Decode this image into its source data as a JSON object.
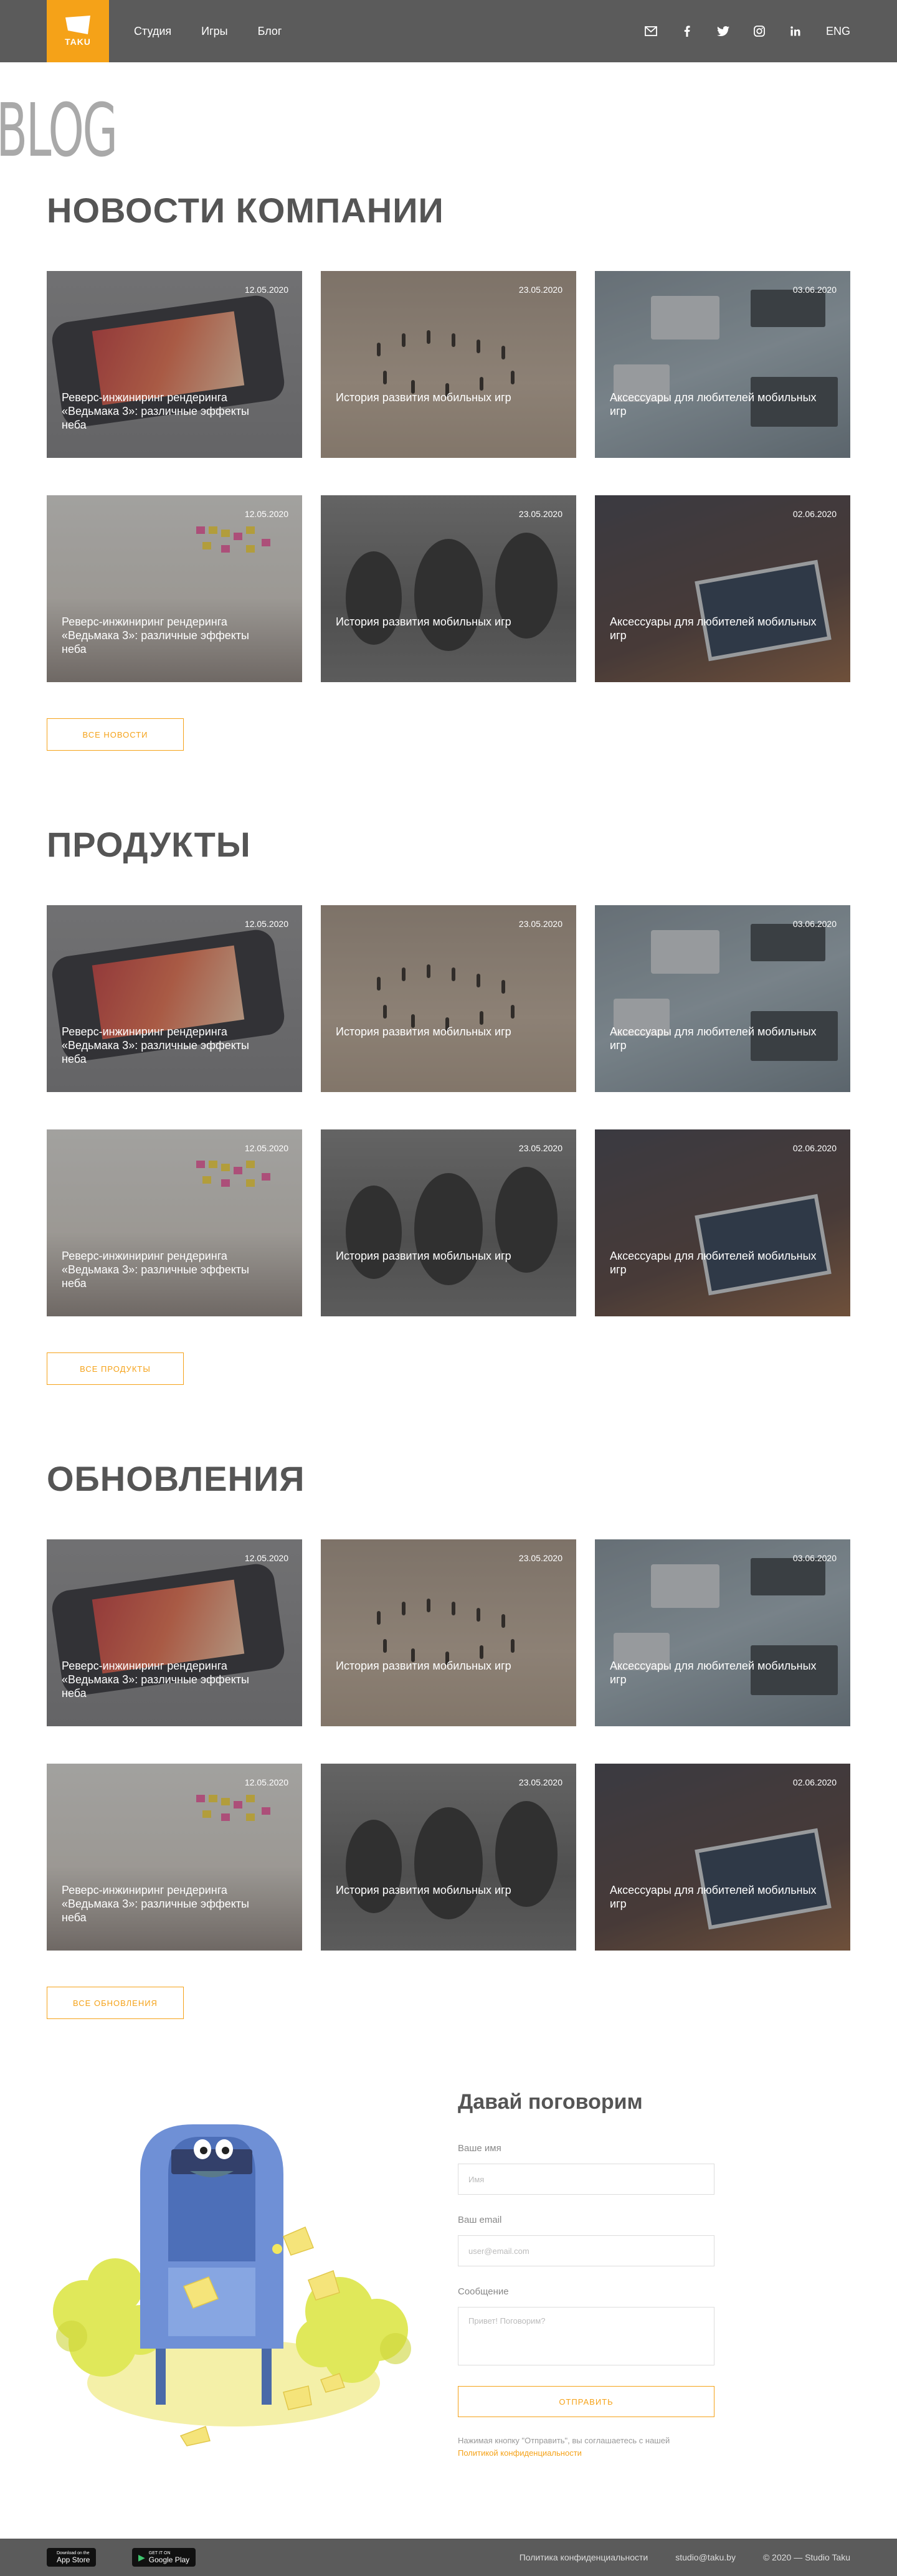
{
  "header": {
    "logo_text": "TAKU",
    "nav": [
      "Студия",
      "Игры",
      "Блог"
    ],
    "icons": [
      "mail-icon",
      "facebook-icon",
      "twitter-icon",
      "instagram-icon",
      "linkedin-icon"
    ],
    "lang": "ENG"
  },
  "blog_word": "BLOG",
  "sections": [
    {
      "title": "НОВОСТИ КОМПАНИИ",
      "button": "ВСЕ НОВОСТИ",
      "cards": [
        {
          "date": "12.05.2020",
          "title": "Реверс-инжиниринг рендеринга «Ведьмака 3»: различные эффекты неба"
        },
        {
          "date": "23.05.2020",
          "title": "История развития мобильных игр"
        },
        {
          "date": "03.06.2020",
          "title": "Аксессуары для любителей мобильных игр"
        },
        {
          "date": "12.05.2020",
          "title": "Реверс-инжиниринг рендеринга «Ведьмака 3»: различные эффекты неба"
        },
        {
          "date": "23.05.2020",
          "title": "История развития мобильных игр"
        },
        {
          "date": "02.06.2020",
          "title": "Аксессуары для любителей мобильных игр"
        }
      ]
    },
    {
      "title": "ПРОДУКТЫ",
      "button": "ВСЕ ПРОДУКТЫ",
      "cards": [
        {
          "date": "12.05.2020",
          "title": "Реверс-инжиниринг рендеринга «Ведьмака 3»: различные эффекты неба"
        },
        {
          "date": "23.05.2020",
          "title": "История развития мобильных игр"
        },
        {
          "date": "03.06.2020",
          "title": "Аксессуары для любителей мобильных игр"
        },
        {
          "date": "12.05.2020",
          "title": "Реверс-инжиниринг рендеринга «Ведьмака 3»: различные эффекты неба"
        },
        {
          "date": "23.05.2020",
          "title": "История развития мобильных игр"
        },
        {
          "date": "02.06.2020",
          "title": "Аксессуары для любителей мобильных игр"
        }
      ]
    },
    {
      "title": "ОБНОВЛЕНИЯ",
      "button": "ВСЕ ОБНОВЛЕНИЯ",
      "cards": [
        {
          "date": "12.05.2020",
          "title": "Реверс-инжиниринг рендеринга «Ведьмака 3»: различные эффекты неба"
        },
        {
          "date": "23.05.2020",
          "title": "История развития мобильных игр"
        },
        {
          "date": "03.06.2020",
          "title": "Аксессуары для любителей мобильных игр"
        },
        {
          "date": "12.05.2020",
          "title": "Реверс-инжиниринг рендеринга «Ведьмака 3»: различные эффекты неба"
        },
        {
          "date": "23.05.2020",
          "title": "История развития мобильных игр"
        },
        {
          "date": "02.06.2020",
          "title": "Аксессуары для любителей мобильных игр"
        }
      ]
    }
  ],
  "contact": {
    "title": "Давай поговорим",
    "name_label": "Ваше имя",
    "name_placeholder": "Имя",
    "email_label": "Ваш email",
    "email_placeholder": "user@email.com",
    "message_label": "Сообщение",
    "message_placeholder": "Привет! Поговорим?",
    "send": "ОТПРАВИТЬ",
    "consent": "Нажимая кнопку \"Отправить\", вы соглашаетесь с нашей",
    "consent_link": "Политикой конфиденциальности"
  },
  "footer": {
    "appstore_small": "Download on the",
    "appstore_big": "App Store",
    "googleplay_small": "GET IT ON",
    "googleplay_big": "Google Play",
    "privacy": "Политика конфиденциальности",
    "email": "studio@taku.by",
    "copyright": "© 2020 — Studio Taku"
  },
  "colors": {
    "accent": "#f5a218",
    "header_bg": "#5b5b5b",
    "heading": "#555555"
  }
}
